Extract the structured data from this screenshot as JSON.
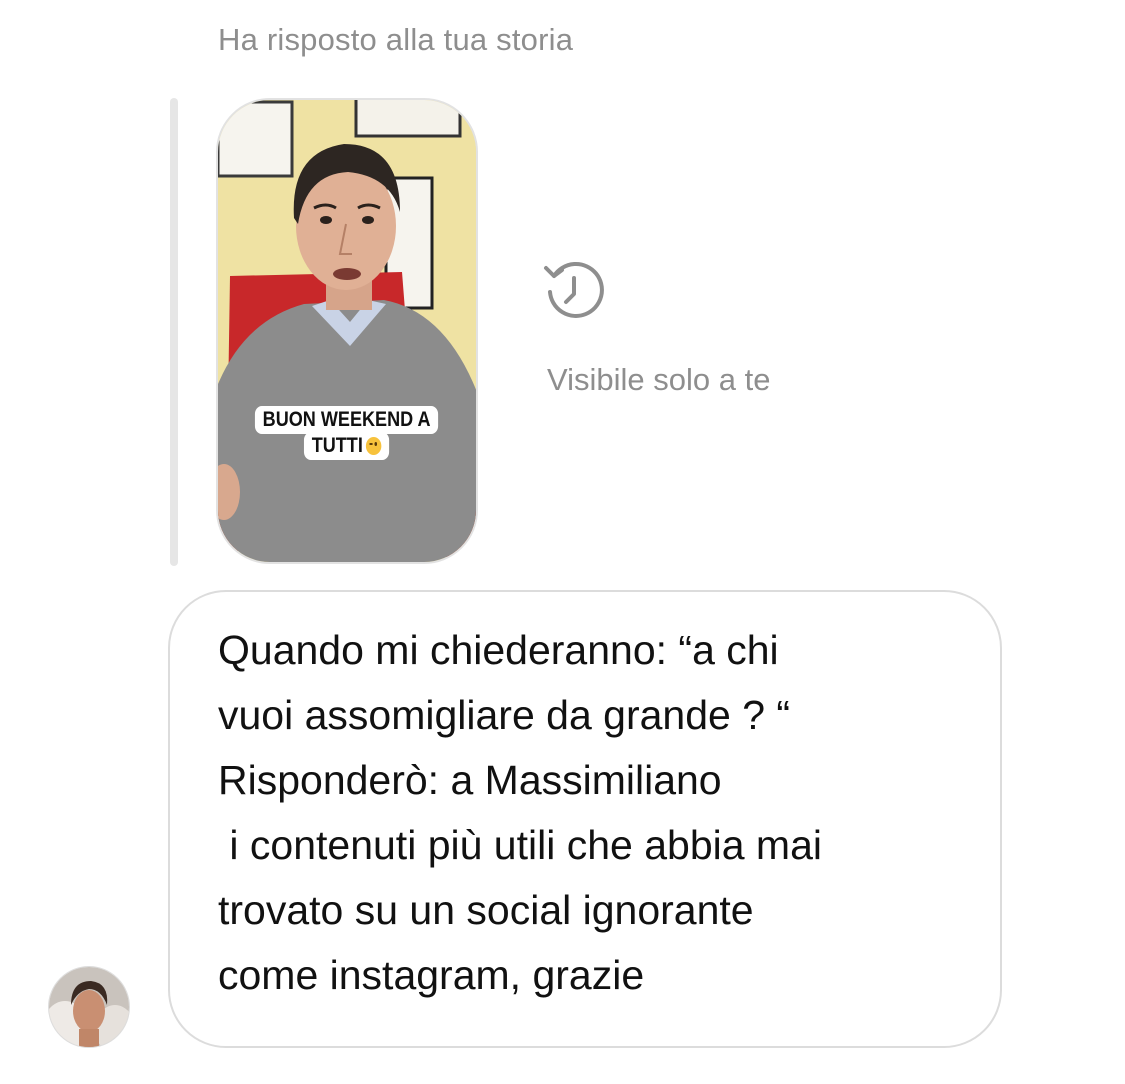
{
  "reply_context": {
    "header": "Ha risposto alla tua storia",
    "story_caption_line1": "BUON WEEKEND A",
    "story_caption_line2": "TUTTI",
    "expired_icon": "history-clock-icon",
    "visibility_note": "Visibile solo a te"
  },
  "message": {
    "text": "Quando mi chiederanno: “a chi\nvuoi assomigliare da grande ? “\nRisponderò: a Massimiliano\n i contenuti più utili che abbia mai\ntrovato su un social ignorante\ncome instagram, grazie"
  },
  "colors": {
    "secondary_text": "#8e8e8e",
    "bubble_border": "#dcdcdc",
    "primary_text": "#111111"
  }
}
